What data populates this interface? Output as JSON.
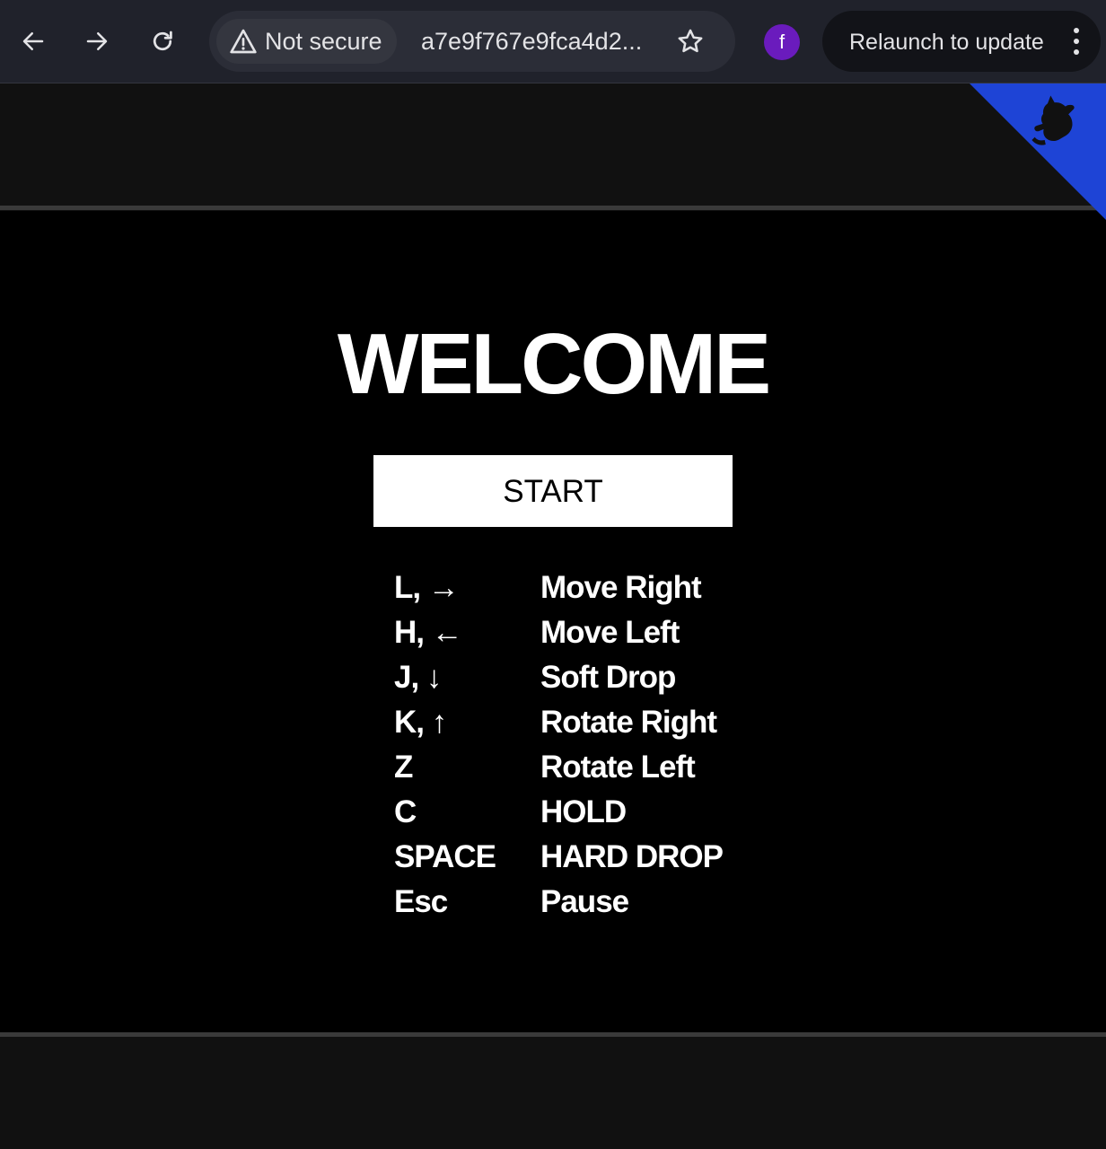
{
  "browser": {
    "security_label": "Not secure",
    "url": "a7e9f767e9fca4d2...",
    "profile_initial": "f",
    "relaunch_label": "Relaunch to update"
  },
  "colors": {
    "corner_ribbon": "#1e44d6",
    "profile_avatar": "#6a1bbd"
  },
  "game": {
    "title": "WELCOME",
    "start_label": "START",
    "controls": [
      {
        "key": "L, →",
        "action": "Move Right"
      },
      {
        "key": "H, ←",
        "action": "Move Left"
      },
      {
        "key": "J, ↓",
        "action": "Soft Drop"
      },
      {
        "key": "K, ↑",
        "action": "Rotate Right"
      },
      {
        "key": "Z",
        "action": "Rotate Left"
      },
      {
        "key": "C",
        "action": "HOLD"
      },
      {
        "key": "SPACE",
        "action": "HARD DROP"
      },
      {
        "key": "Esc",
        "action": "Pause"
      }
    ]
  }
}
